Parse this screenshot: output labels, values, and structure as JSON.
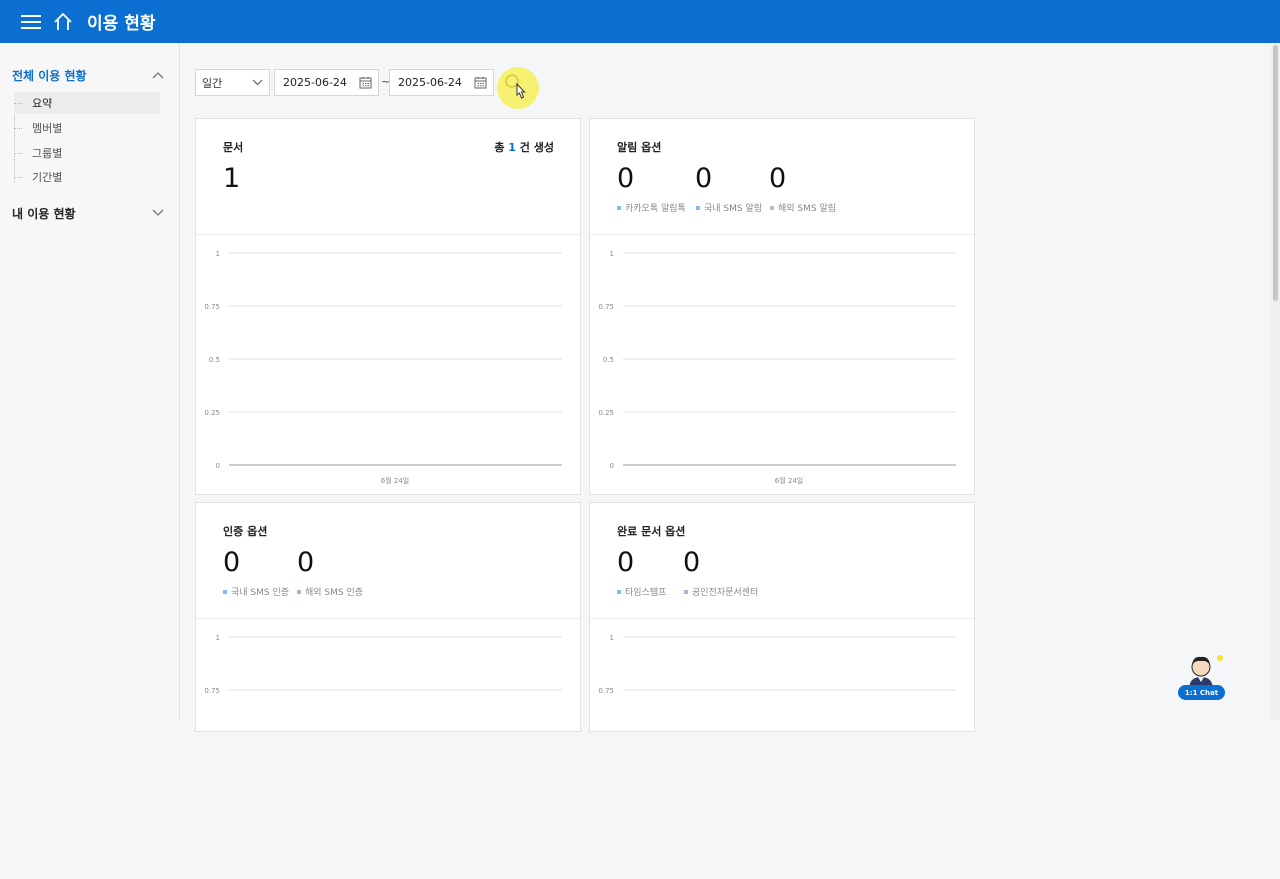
{
  "header": {
    "title": "이용 현황"
  },
  "sidebar": {
    "groups": [
      {
        "label": "전체 이용 현황",
        "expanded": true
      },
      {
        "label": "내 이용 현황",
        "expanded": false
      }
    ],
    "items": [
      {
        "label": "요약",
        "active": true
      },
      {
        "label": "멤버별"
      },
      {
        "label": "그룹별"
      },
      {
        "label": "기간별"
      }
    ]
  },
  "filter": {
    "period": "일간",
    "start_date": "2025-06-24",
    "separator": "~",
    "end_date": "2025-06-24"
  },
  "cards": [
    {
      "title": "문서",
      "total_prefix": "총",
      "total_value": "1",
      "total_suffix": "건 생성",
      "stats": [
        {
          "value": "1"
        }
      ],
      "chart": {
        "ticks": [
          "1",
          "0.75",
          "0.5",
          "0.25",
          "0"
        ],
        "x_label": "6월 24일"
      }
    },
    {
      "title": "알림 옵션",
      "stats": [
        {
          "value": "0",
          "label": "카카오톡 알림톡"
        },
        {
          "value": "0",
          "label": "국내 SMS 알림"
        },
        {
          "value": "0",
          "label": "해외 SMS 알림"
        }
      ],
      "chart": {
        "ticks": [
          "1",
          "0.75",
          "0.5",
          "0.25",
          "0"
        ],
        "x_label": "6월 24일"
      }
    },
    {
      "title": "인증 옵션",
      "stats": [
        {
          "value": "0",
          "label": "국내 SMS 인증"
        },
        {
          "value": "0",
          "label": "해외 SMS 인증"
        }
      ],
      "chart": {
        "ticks": [
          "1",
          "0.75"
        ]
      }
    },
    {
      "title": "완료 문서 옵션",
      "stats": [
        {
          "value": "0",
          "label": "타임스탬프"
        },
        {
          "value": "0",
          "label": "공인전자문서센터"
        }
      ],
      "chart": {
        "ticks": [
          "1",
          "0.75"
        ]
      }
    }
  ],
  "chat": {
    "label": "1:1 Chat"
  },
  "colors": {
    "brand": "#0a6fd1",
    "legend": "#8bb8e8"
  }
}
